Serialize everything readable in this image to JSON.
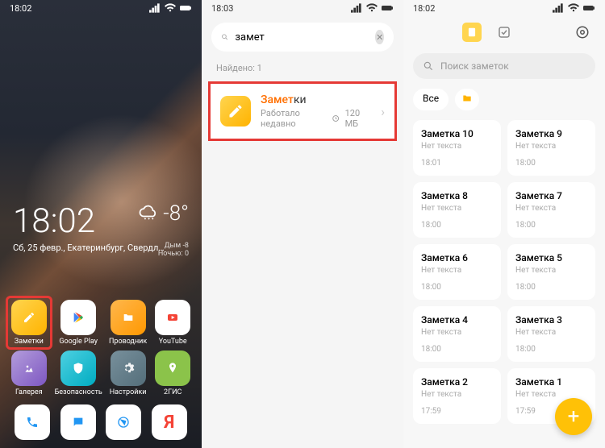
{
  "screen1": {
    "status_time": "18:02",
    "big_time": "18:02",
    "date": "Сб, 25 февр., Екатеринбург, Свердл…",
    "weather_temp": "-8°",
    "weather_sub1": "Дым -8",
    "weather_sub2": "Ночью: 0",
    "apps": [
      {
        "label": "Заметки"
      },
      {
        "label": "Google Play"
      },
      {
        "label": "Проводник"
      },
      {
        "label": "YouTube"
      },
      {
        "label": "Галерея"
      },
      {
        "label": "Безопасность"
      },
      {
        "label": "Настройки"
      },
      {
        "label": "2ГИС"
      }
    ]
  },
  "screen2": {
    "status_time": "18:03",
    "search_value": "замет",
    "found_label": "Найдено: 1",
    "result": {
      "title_hl": "Замет",
      "title_rest": "ки",
      "sub": "Работало недавно",
      "size": "120 МБ"
    }
  },
  "screen3": {
    "status_time": "18:02",
    "search_placeholder": "Поиск заметок",
    "filter_all": "Все",
    "notes": [
      {
        "title": "Заметка 10",
        "body": "Нет текста",
        "time": "18:01"
      },
      {
        "title": "Заметка 9",
        "body": "Нет текста",
        "time": "18:00"
      },
      {
        "title": "Заметка 8",
        "body": "Нет текста",
        "time": "18:00"
      },
      {
        "title": "Заметка 7",
        "body": "Нет текста",
        "time": "18:00"
      },
      {
        "title": "Заметка 6",
        "body": "Нет текста",
        "time": "18:00"
      },
      {
        "title": "Заметка 5",
        "body": "Нет текста",
        "time": "18:00"
      },
      {
        "title": "Заметка 4",
        "body": "Нет текста",
        "time": "18:00"
      },
      {
        "title": "Заметка 3",
        "body": "Нет текста",
        "time": "18:00"
      },
      {
        "title": "Заметка 2",
        "body": "Нет текста",
        "time": "17:59"
      },
      {
        "title": "Заметка 1",
        "body": "Нет текста",
        "time": "17:59"
      }
    ]
  }
}
